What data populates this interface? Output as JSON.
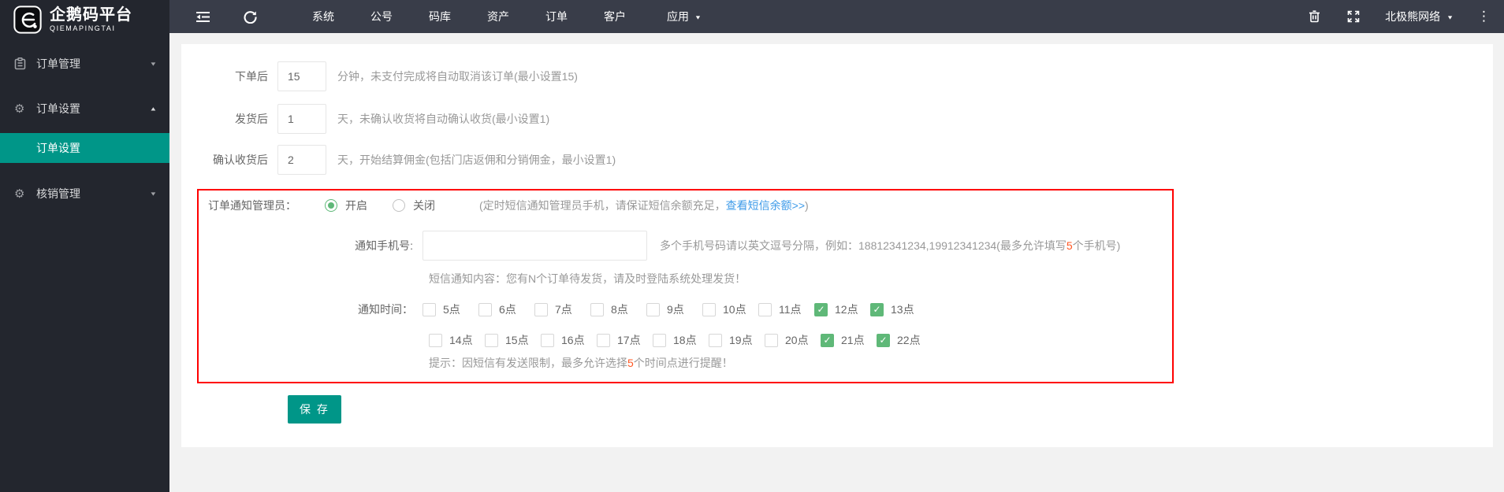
{
  "brand": {
    "title": "企鹅码平台",
    "subtitle": "QIEMAPINGTAI"
  },
  "header": {
    "nav_items": [
      "系统",
      "公号",
      "码库",
      "资产",
      "订单",
      "客户"
    ],
    "apps_menu_label": "应用",
    "account_label": "北极熊网络"
  },
  "sidebar": {
    "items": [
      {
        "label": "订单管理",
        "state": "collapsed"
      },
      {
        "label": "订单设置",
        "state": "expanded"
      },
      {
        "label": "核销管理",
        "state": "collapsed"
      }
    ],
    "active_submenu": "订单设置"
  },
  "form": {
    "rows": [
      {
        "label": "下单后",
        "value": "15",
        "desc": "分钟，未支付完成将自动取消该订单(最小设置15)"
      },
      {
        "label": "发货后",
        "value": "1",
        "desc": "天，未确认收货将自动确认收货(最小设置1)"
      },
      {
        "label": "确认收货后",
        "value": "2",
        "desc": "天，开始结算佣金(包括门店返佣和分销佣金，最小设置1)"
      }
    ],
    "save_label": "保 存"
  },
  "notify": {
    "label": "订单通知管理员：",
    "radio_on": "开启",
    "radio_off": "关闭",
    "note_prefix": "(定时短信通知管理员手机，请保证短信余额充足，",
    "note_link": "查看短信余额>>",
    "note_suffix": ")",
    "phone_label": "通知手机号:",
    "phone_value": "",
    "phone_hint_1": "多个手机号码请以英文逗号分隔，例如：18812341234,19912341234(最多允许填写",
    "phone_hint_red": "5",
    "phone_hint_2": "个手机号)",
    "sms_content": "短信通知内容：您有N个订单待发货，请及时登陆系统处理发货！",
    "time_label": "通知时间：",
    "hours_row1": [
      {
        "label": "5点",
        "checked": false
      },
      {
        "label": "6点",
        "checked": false
      },
      {
        "label": "7点",
        "checked": false
      },
      {
        "label": "8点",
        "checked": false
      },
      {
        "label": "9点",
        "checked": false
      },
      {
        "label": "10点",
        "checked": false
      },
      {
        "label": "11点",
        "checked": false
      },
      {
        "label": "12点",
        "checked": true
      },
      {
        "label": "13点",
        "checked": true
      }
    ],
    "hours_row2": [
      {
        "label": "14点",
        "checked": false
      },
      {
        "label": "15点",
        "checked": false
      },
      {
        "label": "16点",
        "checked": false
      },
      {
        "label": "17点",
        "checked": false
      },
      {
        "label": "18点",
        "checked": false
      },
      {
        "label": "19点",
        "checked": false
      },
      {
        "label": "20点",
        "checked": false
      },
      {
        "label": "21点",
        "checked": true
      },
      {
        "label": "22点",
        "checked": true
      }
    ],
    "tip_1": "提示：因短信有发送限制，最多允许选择",
    "tip_red": "5",
    "tip_2": "个时间点进行提醒！"
  },
  "icons": {
    "logo": "penguin-e-logo",
    "collapse": "menu-collapse",
    "refresh": "refresh-arrow",
    "trash": "trash-can",
    "fullscreen": "expand-arrows",
    "clipboard": "order-clipboard",
    "gear_glyph": "⚙",
    "kebab_glyph": "⋮",
    "check_glyph": "✓",
    "chevron_down_glyph": "▼",
    "chevron_up_glyph": "▲"
  },
  "colors": {
    "accent_teal": "#009688",
    "checkbox_green": "#5FB878",
    "link_blue": "#3E9BE9",
    "warn_red": "#FF5722",
    "box_border_red": "#FF0000",
    "header_bg": "#393D49",
    "sidebar_bg": "#23262E"
  }
}
